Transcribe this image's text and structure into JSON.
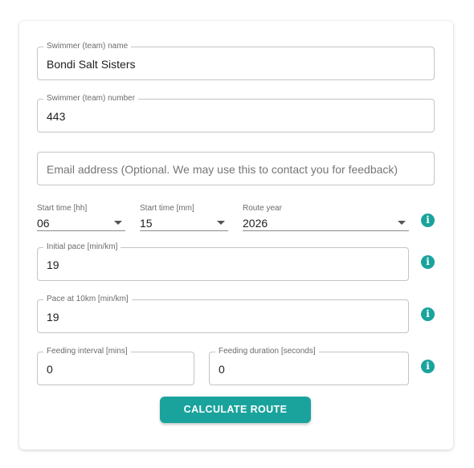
{
  "form": {
    "swimmer_name": {
      "label": "Swimmer (team) name",
      "value": "Bondi Salt Sisters"
    },
    "swimmer_number": {
      "label": "Swimmer (team) number",
      "value": "443"
    },
    "email": {
      "placeholder": "Email address (Optional. We may use this to contact you for feedback)"
    },
    "start_hh": {
      "label": "Start time [hh]",
      "value": "06"
    },
    "start_mm": {
      "label": "Start time [mm]",
      "value": "15"
    },
    "route_year": {
      "label": "Route year",
      "value": "2026"
    },
    "initial_pace": {
      "label": "Initial pace [min/km]",
      "value": "19"
    },
    "pace_10km": {
      "label": "Pace at 10km [min/km]",
      "value": "19"
    },
    "feeding_interval": {
      "label": "Feeding interval [mins]",
      "value": "0"
    },
    "feeding_duration": {
      "label": "Feeding duration [seconds]",
      "value": "0"
    },
    "info_glyph": "i",
    "submit_label": "CALCULATE ROUTE"
  },
  "colors": {
    "accent": "#1aa39c",
    "border": "#c4c4c4"
  }
}
